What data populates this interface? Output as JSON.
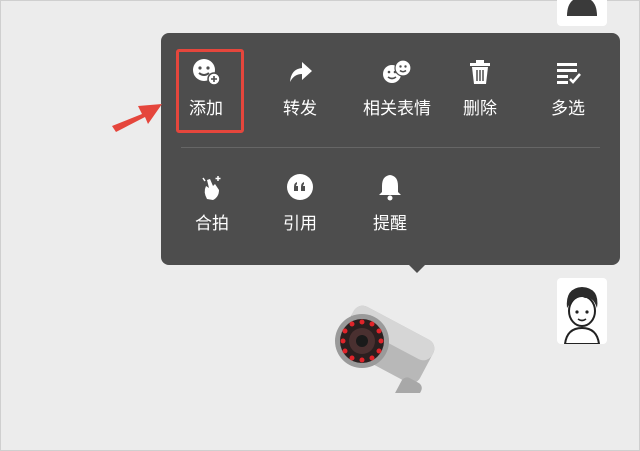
{
  "menu": {
    "row1": [
      {
        "label": "添加",
        "icon": "sticker-add-icon"
      },
      {
        "label": "转发",
        "icon": "forward-icon"
      },
      {
        "label": "相关表情",
        "icon": "related-stickers-icon"
      },
      {
        "label": "删除",
        "icon": "trash-icon"
      },
      {
        "label": "多选",
        "icon": "multi-select-icon"
      }
    ],
    "row2": [
      {
        "label": "合拍",
        "icon": "pat-icon"
      },
      {
        "label": "引用",
        "icon": "quote-icon"
      },
      {
        "label": "提醒",
        "icon": "bell-icon"
      }
    ]
  },
  "colors": {
    "menu_bg": "#4d4d4d",
    "highlight": "#e5463c",
    "canvas": "#ececec"
  }
}
